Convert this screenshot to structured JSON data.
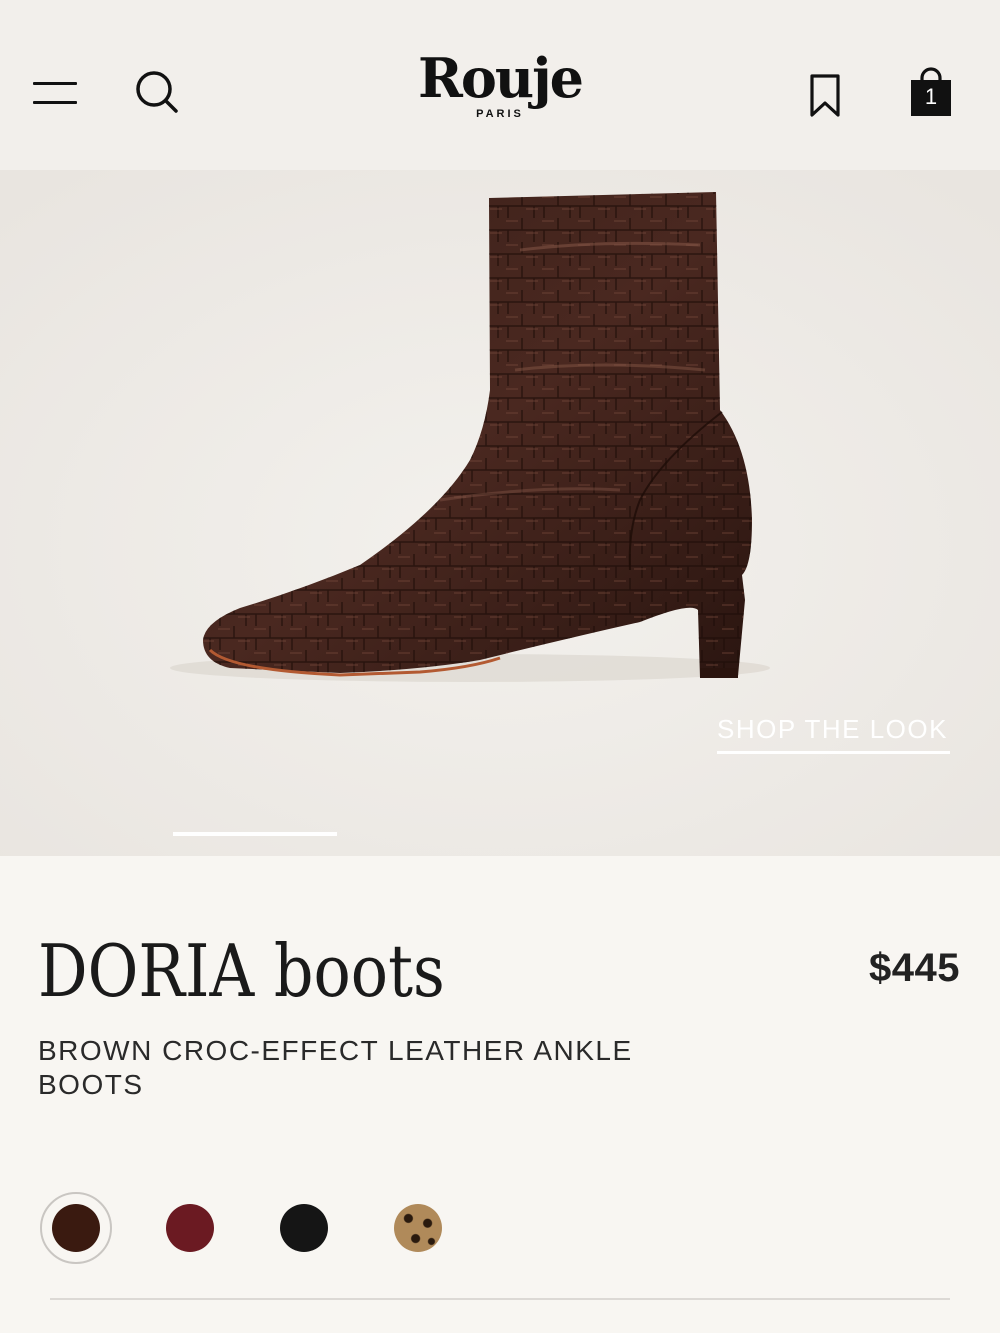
{
  "header": {
    "logo": "Rouje",
    "logo_sub": "PARIS",
    "cart_count": "1"
  },
  "hero": {
    "shop_the_look": "SHOP THE LOOK",
    "carousel_progress": 0.2
  },
  "product": {
    "name": "DORIA boots",
    "price": "$445",
    "description": "BROWN CROC-EFFECT LEATHER ANKLE BOOTS"
  },
  "swatches": [
    {
      "name": "brown",
      "color": "#3a1a10",
      "selected": true
    },
    {
      "name": "burgundy",
      "color": "#6b1a22",
      "selected": false
    },
    {
      "name": "black",
      "color": "#151515",
      "selected": false
    },
    {
      "name": "leopard",
      "color": "#b08a5a",
      "selected": false
    }
  ],
  "colors": {
    "header_bg": "#f2efeb",
    "hero_bg": "#efece7",
    "page_bg": "#f8f6f2",
    "boot_leather": "#3b1f17"
  }
}
